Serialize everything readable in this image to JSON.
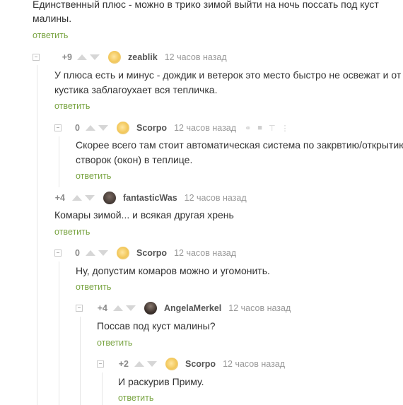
{
  "colors": {
    "reply_link": "#79a442",
    "thread_line": "#e6e6e6",
    "arrow": "#d6d6d6",
    "username": "#555555",
    "time": "#999999"
  },
  "top_comment": {
    "text_line1": "Единственный плюс - можно в трико зимой выйти на ночь поссать под куст",
    "text_line2": "малины.",
    "reply": "ответить"
  },
  "comments": [
    {
      "rating": "+9",
      "author": "zeablik",
      "time": "12 часов назад",
      "avatar": "blurred-yellow-emoji",
      "lines": [
        "У плюса есть и минус - дождик и ветерок это место быстро не освежат и от",
        "кустика заблагоухает вся тепличка."
      ],
      "reply": "ответить"
    },
    {
      "rating": "0",
      "author": "Scorpo",
      "time": "12 часов назад",
      "avatar": "blurred-yellow-emoji",
      "toolbar_icons": [
        "link-icon",
        "save-icon",
        "pin-icon",
        "more-icon"
      ],
      "lines": [
        "Скорее всего там стоит автоматическая система по закрвтию/открытию",
        "створок (окон) в теплице."
      ],
      "reply": "ответить"
    },
    {
      "rating": "+4",
      "author": "fantasticWas",
      "time": "12 часов назад",
      "avatar": "dark-photo",
      "lines": [
        "Комары зимой... и всякая другая хрень"
      ],
      "reply": "ответить"
    },
    {
      "rating": "0",
      "author": "Scorpo",
      "time": "12 часов назад",
      "avatar": "blurred-yellow-emoji",
      "lines": [
        "Ну, допустим комаров можно и угомонить."
      ],
      "reply": "ответить"
    },
    {
      "rating": "+4",
      "author": "AngelaMerkel",
      "time": "12 часов назад",
      "avatar": "dark-photo",
      "lines": [
        "Поссав под куст малины?"
      ],
      "reply": "ответить"
    },
    {
      "rating": "+2",
      "author": "Scorpo",
      "time": "12 часов назад",
      "avatar": "blurred-yellow-emoji",
      "lines": [
        "И раскурив Приму."
      ],
      "reply": "ответить"
    }
  ]
}
